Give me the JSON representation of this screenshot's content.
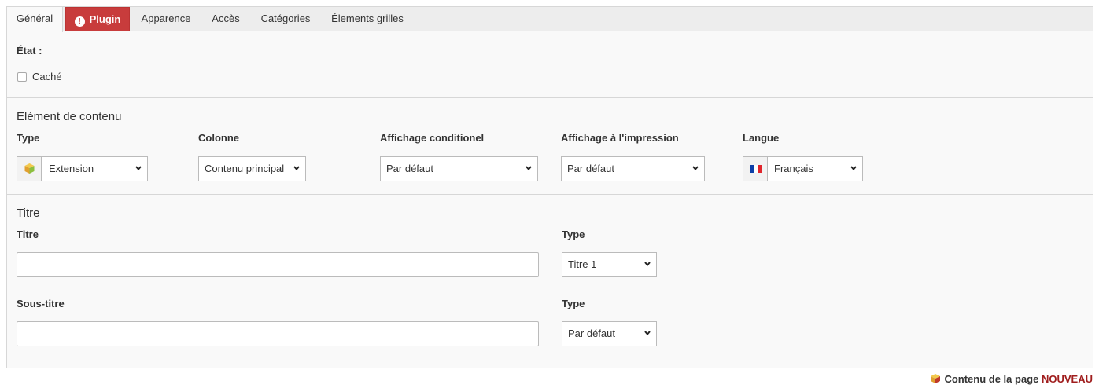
{
  "tabs": [
    {
      "label": "Général",
      "active": true
    },
    {
      "label": "Plugin",
      "error": true
    },
    {
      "label": "Apparence"
    },
    {
      "label": "Accès"
    },
    {
      "label": "Catégories"
    },
    {
      "label": "Élements grilles"
    }
  ],
  "error_badge": "!",
  "state": {
    "heading": "État :",
    "hidden_label": "Caché",
    "hidden_checked": false
  },
  "content_element": {
    "section_title": "Elément de contenu",
    "type_label": "Type",
    "type_value": "Extension",
    "type_icon": "extension-cube-icon",
    "column_label": "Colonne",
    "column_value": "Contenu principal",
    "conditional_label": "Affichage conditionel",
    "conditional_value": "Par défaut",
    "print_label": "Affichage à l'impression",
    "print_value": "Par défaut",
    "language_label": "Langue",
    "language_value": "Français",
    "language_icon": "flag-fr-icon"
  },
  "title_section": {
    "section_title": "Titre",
    "title_label": "Titre",
    "title_value": "",
    "title_type_label": "Type",
    "title_type_value": "Titre 1",
    "subtitle_label": "Sous-titre",
    "subtitle_value": "",
    "subtitle_type_label": "Type",
    "subtitle_type_value": "Par défaut"
  },
  "footer": {
    "text": "Contenu de la page",
    "badge": "NOUVEAU",
    "icon": "content-cube-icon"
  },
  "colors": {
    "error_tab": "#c83c3c",
    "new_badge": "#a01e1e",
    "flag_blue": "#0d3fa8",
    "flag_red": "#e1252c"
  }
}
